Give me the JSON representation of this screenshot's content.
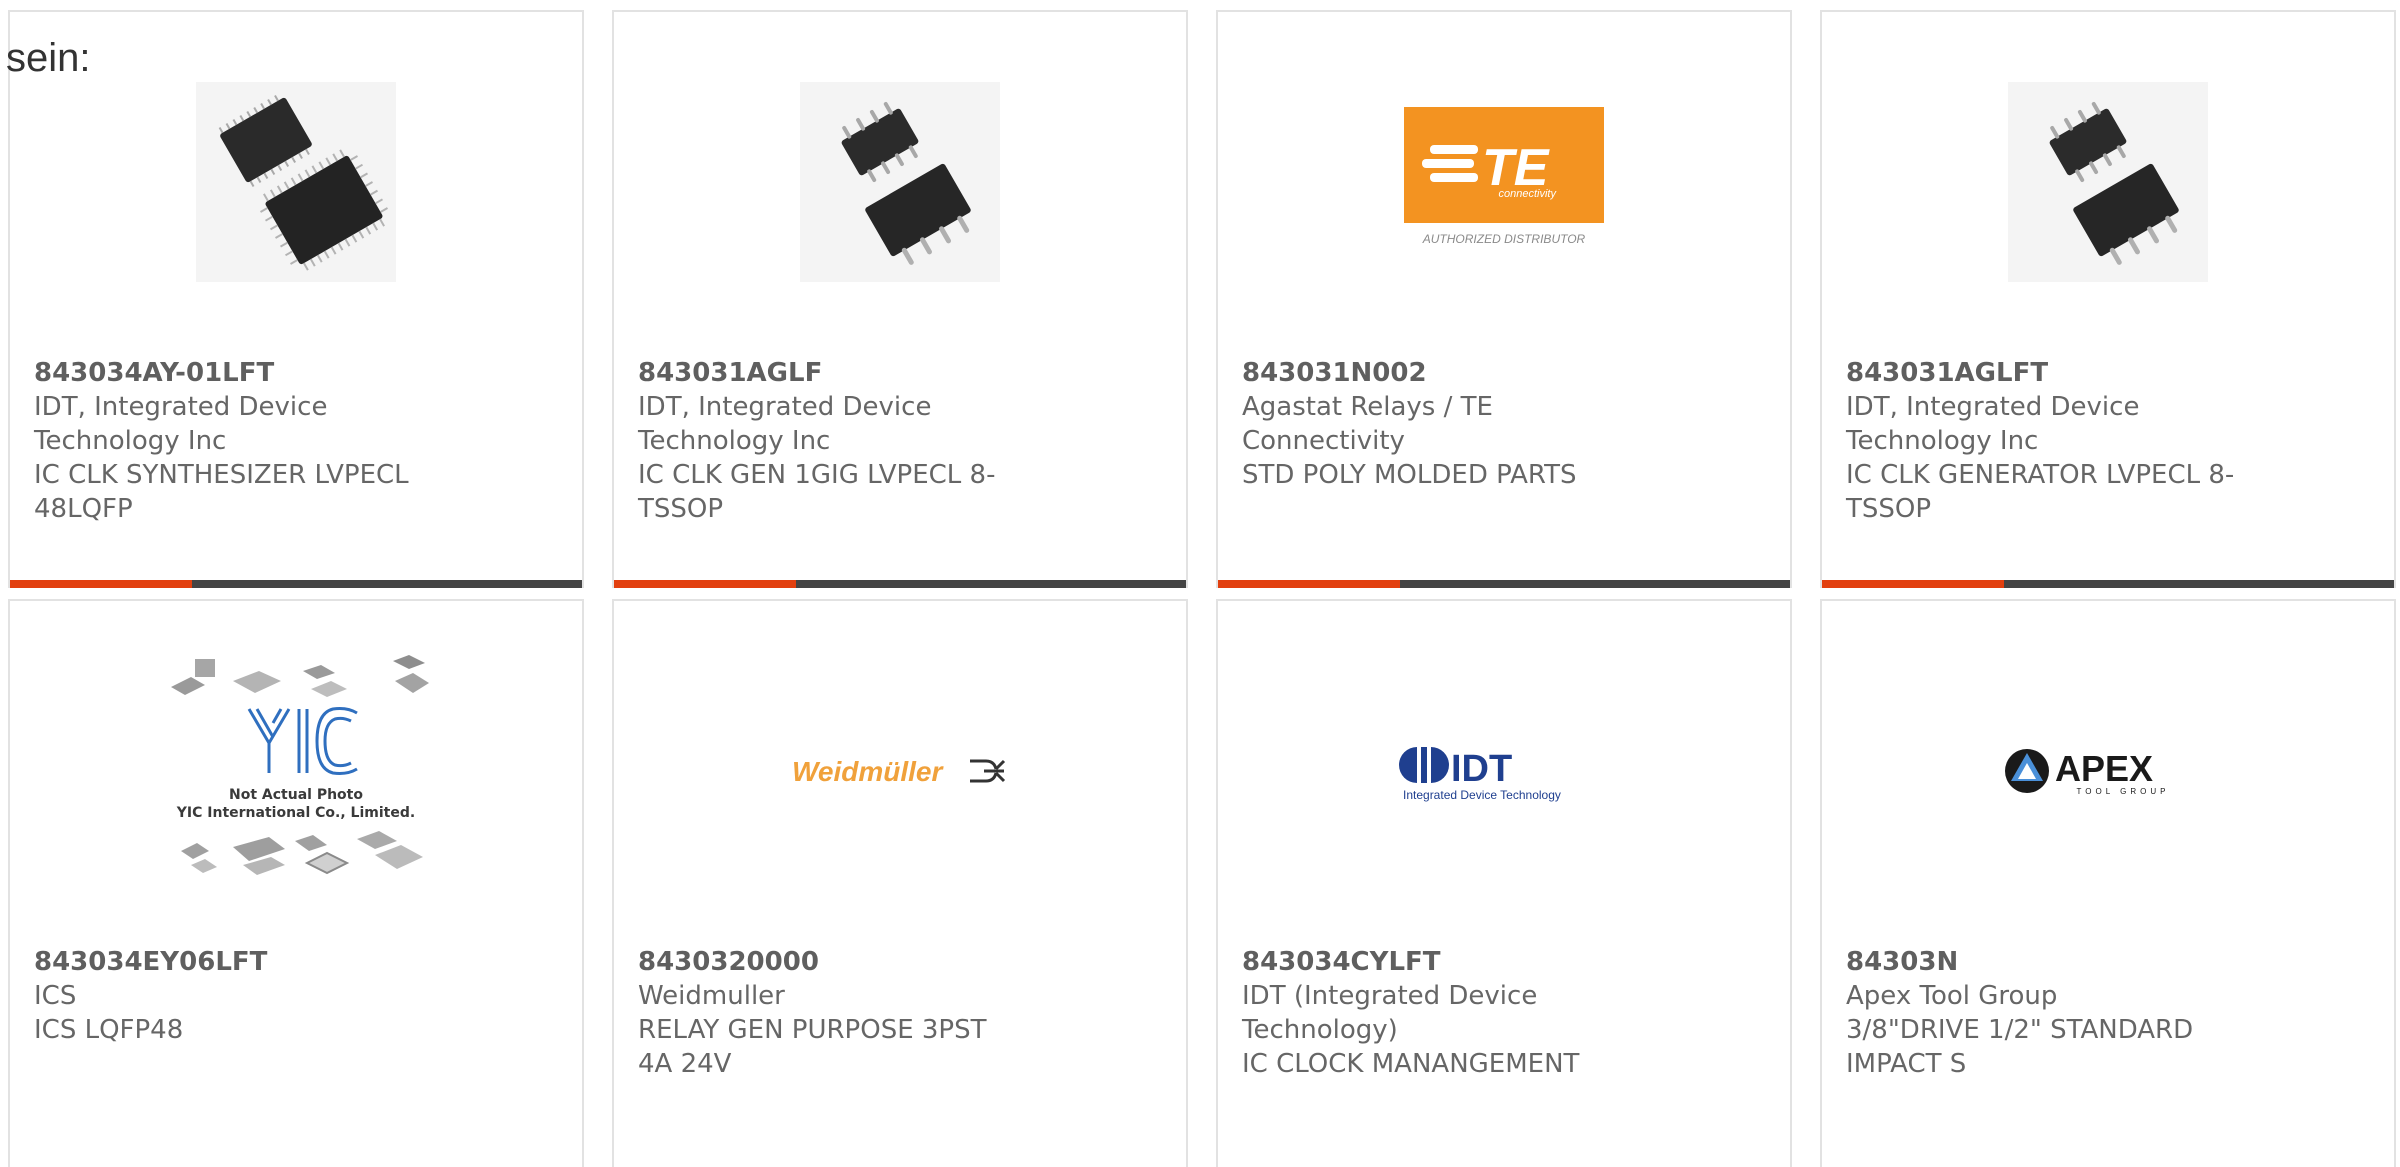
{
  "intro": {
    "text": "sein:"
  },
  "colors": {
    "bar_accent": "#e2400f",
    "bar_base": "#444444",
    "card_border": "#e2e2e2",
    "text": "#666666"
  },
  "products": [
    {
      "part_number": "843034AY-01LFT",
      "manufacturer": "IDT, Integrated Device Technology Inc",
      "description": "IC CLK SYNTHESIZER LVPECL 48LQFP",
      "image": "lqfp-chip-photo"
    },
    {
      "part_number": "843031AGLF",
      "manufacturer": "IDT, Integrated Device Technology Inc",
      "description": "IC CLK GEN 1GIG LVPECL 8-TSSOP",
      "image": "tssop-chip-photo"
    },
    {
      "part_number": "843031N002",
      "manufacturer": "Agastat Relays / TE Connectivity",
      "description": "STD POLY MOLDED PARTS",
      "image": "te-connectivity-logo",
      "logo": {
        "brand": "TE",
        "tagline": "connectivity",
        "caption": "AUTHORIZED DISTRIBUTOR"
      }
    },
    {
      "part_number": "843031AGLFT",
      "manufacturer": "IDT, Integrated Device Technology Inc",
      "description": "IC CLK GENERATOR LVPECL 8-TSSOP",
      "image": "tssop-chip-photo"
    },
    {
      "part_number": "843034EY06LFT",
      "manufacturer": "ICS",
      "description": "ICS LQFP48",
      "image": "yic-not-actual-photo",
      "logo": {
        "brand": "YIC",
        "caption_1": "Not Actual Photo",
        "caption_2": "YIC International Co., Limited."
      }
    },
    {
      "part_number": "8430320000",
      "manufacturer": "Weidmuller",
      "description": "RELAY GEN PURPOSE 3PST 4A 24V",
      "image": "weidmuller-logo",
      "logo": {
        "brand": "Weidmüller"
      }
    },
    {
      "part_number": "843034CYLFT",
      "manufacturer": "IDT (Integrated Device Technology)",
      "description": "IC CLOCK MANANGEMENT",
      "image": "idt-logo",
      "logo": {
        "brand": "IDT",
        "tagline": "Integrated Device Technology"
      }
    },
    {
      "part_number": "84303N",
      "manufacturer": "Apex Tool Group",
      "description": "3/8\"DRIVE 1/2\" STANDARD IMPACT S",
      "image": "apex-tool-group-logo",
      "logo": {
        "brand": "APEX",
        "tagline": "TOOL GROUP"
      }
    }
  ]
}
